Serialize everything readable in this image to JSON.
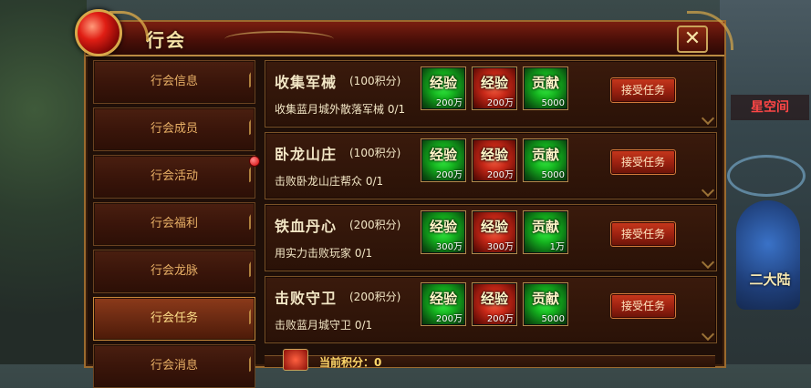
{
  "panel": {
    "title": "行会",
    "close_label": "✕"
  },
  "sidebar": {
    "items": [
      {
        "label": "行会信息",
        "active": false,
        "badge": false
      },
      {
        "label": "行会成员",
        "active": false,
        "badge": false
      },
      {
        "label": "行会活动",
        "active": false,
        "badge": true
      },
      {
        "label": "行会福利",
        "active": false,
        "badge": false
      },
      {
        "label": "行会龙脉",
        "active": false,
        "badge": false
      },
      {
        "label": "行会任务",
        "active": true,
        "badge": false
      },
      {
        "label": "行会消息",
        "active": false,
        "badge": false
      }
    ]
  },
  "tasks": [
    {
      "name": "收集军械",
      "points": "(100积分)",
      "desc": "收集蓝月城外散落军械 0/1",
      "rewards": [
        {
          "title": "经验",
          "amount": "200万",
          "color": "green"
        },
        {
          "title": "经验",
          "amount": "200万",
          "color": "red"
        },
        {
          "title": "贡献",
          "amount": "5000",
          "color": "green"
        }
      ],
      "accept": "接受任务"
    },
    {
      "name": "卧龙山庄",
      "points": "(100积分)",
      "desc": "击败卧龙山庄帮众 0/1",
      "rewards": [
        {
          "title": "经验",
          "amount": "200万",
          "color": "green"
        },
        {
          "title": "经验",
          "amount": "200万",
          "color": "red"
        },
        {
          "title": "贡献",
          "amount": "5000",
          "color": "green"
        }
      ],
      "accept": "接受任务"
    },
    {
      "name": "铁血丹心",
      "points": "(200积分)",
      "desc": "用实力击败玩家 0/1",
      "rewards": [
        {
          "title": "经验",
          "amount": "300万",
          "color": "green"
        },
        {
          "title": "经验",
          "amount": "300万",
          "color": "red"
        },
        {
          "title": "贡献",
          "amount": "1万",
          "color": "green"
        }
      ],
      "accept": "接受任务"
    },
    {
      "name": "击败守卫",
      "points": "(200积分)",
      "desc": "击败蓝月城守卫 0/1",
      "rewards": [
        {
          "title": "经验",
          "amount": "200万",
          "color": "green"
        },
        {
          "title": "经验",
          "amount": "200万",
          "color": "red"
        },
        {
          "title": "贡献",
          "amount": "5000",
          "color": "green"
        }
      ],
      "accept": "接受任务"
    }
  ],
  "footer": {
    "current_points": "当前积分：0"
  },
  "scene": {
    "right_tag": "星空间",
    "right_banner": "二大陆"
  },
  "colors": {
    "accent_gold": "#d8a84a",
    "title_red": "#7a1e10",
    "green_reward": "#14b01e",
    "red_reward": "#c82818"
  }
}
